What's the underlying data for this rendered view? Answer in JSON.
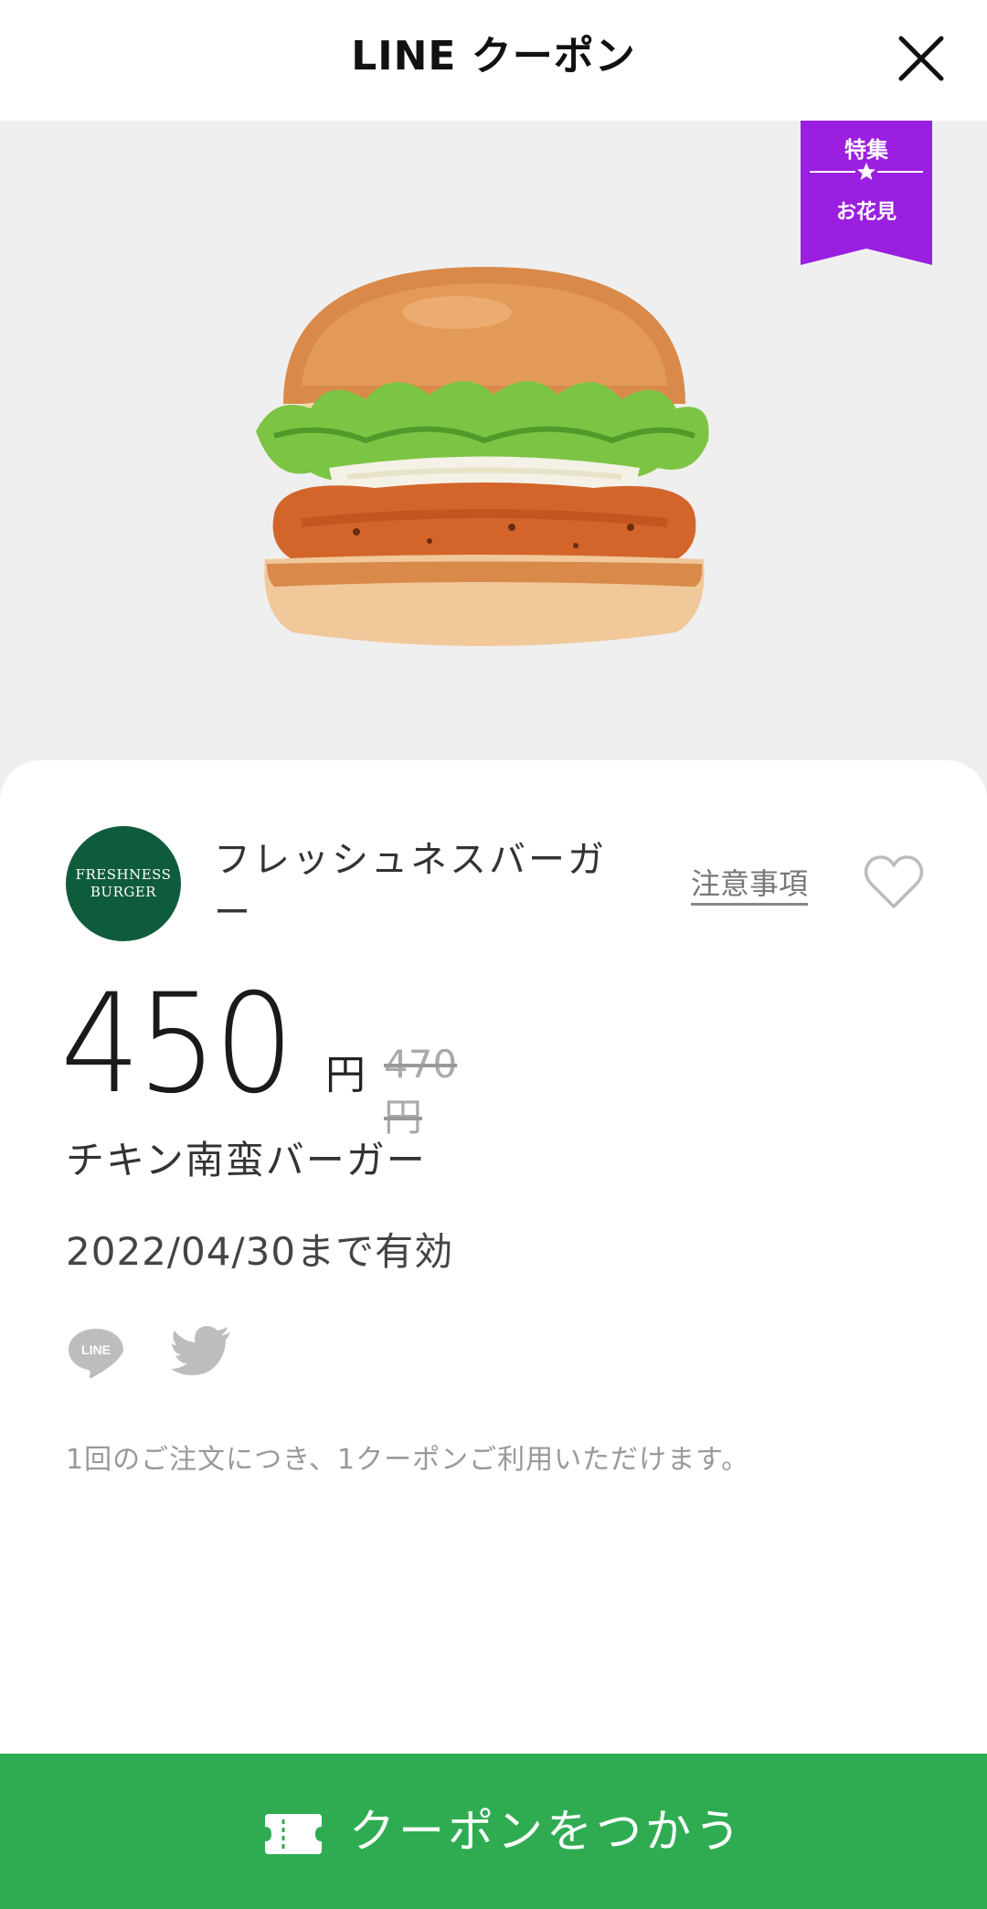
{
  "header": {
    "title": "LINE クーポン",
    "close_icon": "close-icon"
  },
  "hero": {
    "image": "burger-photo",
    "ribbon": {
      "top": "特集",
      "bottom": "お花見",
      "color": "#9b1fe0"
    }
  },
  "coupon": {
    "brand_logo_text": [
      "FRESHNESS",
      "BURGER"
    ],
    "brand_name": "フレッシュネスバーガー",
    "notes_label": "注意事項",
    "favorite_icon": "heart-icon",
    "price": "450",
    "price_unit": "円",
    "original_price": "470円",
    "product_name": "チキン南蛮バーガー",
    "validity": "2022/04/30まで有効",
    "share": {
      "line_icon": "line-icon",
      "line_label": "LINE",
      "twitter_icon": "twitter-icon"
    },
    "notice": "1回のご注文につき、1クーポンご利用いただけます。"
  },
  "footer": {
    "cta_label": "クーポンをつかう",
    "cta_icon": "ticket-icon",
    "cta_color": "#2fac52"
  }
}
